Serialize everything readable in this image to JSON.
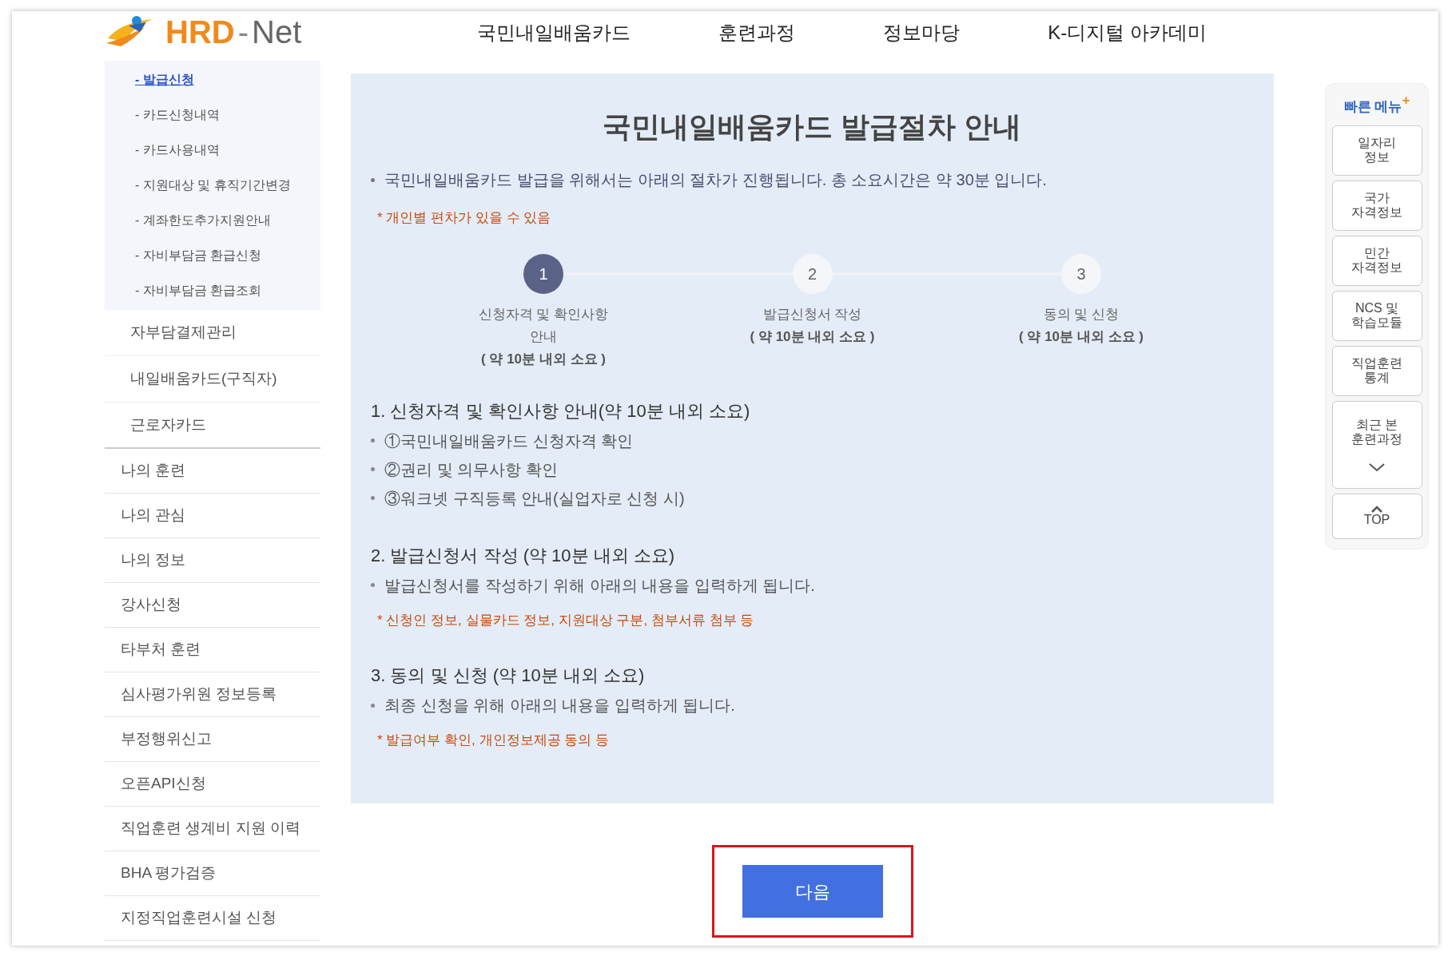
{
  "logo": {
    "brand": "HRD",
    "dash": "-",
    "suffix": "Net"
  },
  "nav": [
    "국민내일배움카드",
    "훈련과정",
    "정보마당",
    "K-디지털 아카데미"
  ],
  "sidebar": {
    "sub_links": [
      {
        "label": "- 발급신청",
        "selected": true
      },
      {
        "label": "- 카드신청내역",
        "selected": false
      },
      {
        "label": "- 카드사용내역",
        "selected": false
      },
      {
        "label": "- 지원대상 및 휴직기간변경",
        "selected": false
      },
      {
        "label": "- 계좌한도추가지원안내",
        "selected": false
      },
      {
        "label": "- 자비부담금 환급신청",
        "selected": false
      },
      {
        "label": "- 자비부담금 환급조회",
        "selected": false
      }
    ],
    "sections": [
      "자부담결제관리",
      "내일배움카드(구직자)",
      "근로자카드"
    ],
    "items": [
      "나의 훈련",
      "나의 관심",
      "나의 정보",
      "강사신청",
      "타부처 훈련",
      "심사평가위원 정보등록",
      "부정행위신고",
      "오픈API신청",
      "직업훈련 생계비 지원 이력",
      "BHA 평가검증",
      "지정직업훈련시설 신청"
    ]
  },
  "guide": {
    "title": "국민내일배움카드 발급절차 안내",
    "intro": "국민내일배움카드 발급을 위해서는 아래의 절차가 진행됩니다. 총 소요시간은 약 30분 입니다.",
    "note": "* 개인별 편차가 있을 수 있음",
    "steps": [
      {
        "number": "1",
        "label": "신청자격 및 확인사항 안내",
        "time": "( 약 10분 내외 소요 )",
        "selected": true
      },
      {
        "number": "2",
        "label": "발급신청서 작성",
        "time": "( 약 10분 내외 소요 )",
        "selected": false
      },
      {
        "number": "3",
        "label": "동의 및 신청",
        "time": "( 약 10분 내외 소요 )",
        "selected": false
      }
    ],
    "sections": [
      {
        "heading": "1. 신청자격 및 확인사항 안내(약 10분 내외 소요)",
        "bullets": [
          "①국민내일배움카드 신청자격 확인",
          "②권리 및 의무사항 확인",
          "③워크넷 구직등록 안내(실업자로 신청 시)"
        ]
      },
      {
        "heading": "2. 발급신청서 작성 (약 10분 내외 소요)",
        "bullets": [
          "발급신청서를 작성하기 위해 아래의 내용을 입력하게 됩니다."
        ],
        "note": "* 신청인 정보, 실물카드 정보, 지원대상 구분, 첨부서류 첨부 등"
      },
      {
        "heading": "3. 동의 및 신청 (약 10분 내외 소요)",
        "bullets": [
          "최종 신청을 위해 아래의 내용을 입력하게 됩니다."
        ],
        "note": "* 발급여부 확인, 개인정보제공 동의 등"
      }
    ]
  },
  "next_button": {
    "label": "다음",
    "highlighted": true
  },
  "quick_menu": {
    "title": "빠른 메뉴",
    "plus": "+",
    "items": [
      {
        "kind": "link",
        "label": "일자리\n정보"
      },
      {
        "kind": "link",
        "label": "국가\n자격정보"
      },
      {
        "kind": "link",
        "label": "민간\n자격정보"
      },
      {
        "kind": "link",
        "label": "NCS 및\n학습모듈"
      },
      {
        "kind": "link",
        "label": "직업훈련\n통계"
      },
      {
        "kind": "recent",
        "label": "최근 본\n훈련과정"
      },
      {
        "kind": "top",
        "label": "TOP"
      }
    ]
  }
}
